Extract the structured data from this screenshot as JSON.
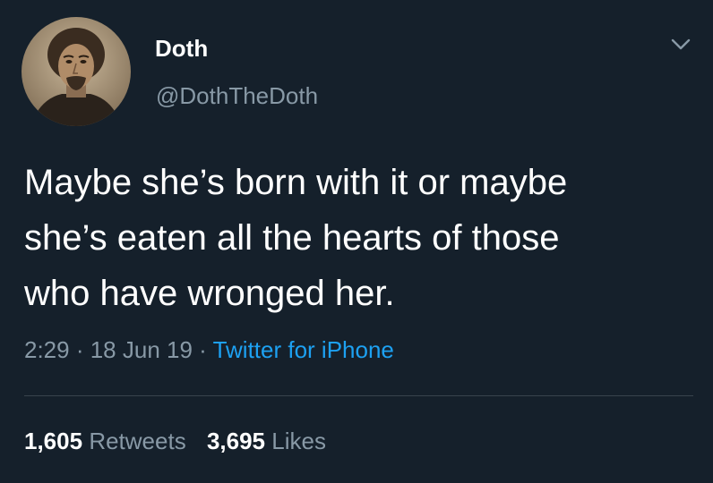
{
  "tweet": {
    "author": {
      "display_name": "Doth",
      "handle": "@DothTheDoth",
      "avatar": "portrait-avatar"
    },
    "menu_icon": "chevron-down-icon",
    "text_lines": [
      "Maybe she’s born with it or maybe",
      "she’s eaten all the hearts of those",
      "who have wronged her."
    ],
    "time": "2:29",
    "separator": " · ",
    "date": "18 Jun 19",
    "source": "Twitter for iPhone",
    "stats": {
      "retweets_count": "1,605",
      "retweets_label": "Retweets",
      "likes_count": "3,695",
      "likes_label": "Likes"
    }
  },
  "colors": {
    "background": "#15202b",
    "primary_text": "#ffffff",
    "secondary_text": "#8899a6",
    "link": "#1da1f2",
    "divider": "#38444d"
  }
}
